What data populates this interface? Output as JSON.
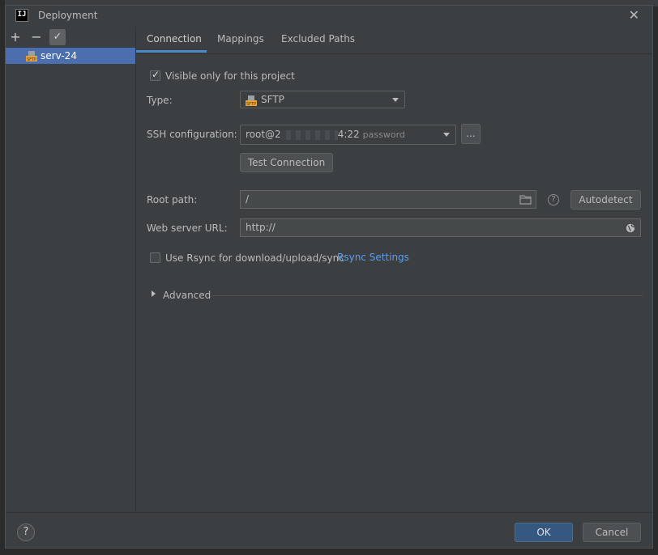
{
  "window": {
    "title": "Deployment"
  },
  "toolbar": {
    "add": "+",
    "remove": "−",
    "apply": "✓"
  },
  "servers": [
    {
      "name": "serv-24",
      "icon": "sftp-icon"
    }
  ],
  "tabs": [
    {
      "label": "Connection"
    },
    {
      "label": "Mappings"
    },
    {
      "label": "Excluded Paths"
    }
  ],
  "connection": {
    "visible_only_label": "Visible only for this project",
    "type_label": "Type:",
    "type_value": "SFTP",
    "ssh_label": "SSH configuration:",
    "ssh_value_prefix": "root@2",
    "ssh_value_suffix": "4:22",
    "ssh_hint": "password",
    "ssh_browse": "...",
    "test_button": "Test Connection",
    "root_path_label": "Root path:",
    "root_path_value": "/",
    "autodetect_button": "Autodetect",
    "web_url_label": "Web server URL:",
    "web_url_value": "http://",
    "rsync_label": "Use Rsync for download/upload/sync",
    "rsync_link": "Rsync Settings",
    "advanced_label": "Advanced"
  },
  "footer": {
    "help": "?",
    "ok": "OK",
    "cancel": "Cancel"
  },
  "colors": {
    "accent": "#4b6eaf",
    "link": "#589df6",
    "ok_button": "#365880"
  }
}
